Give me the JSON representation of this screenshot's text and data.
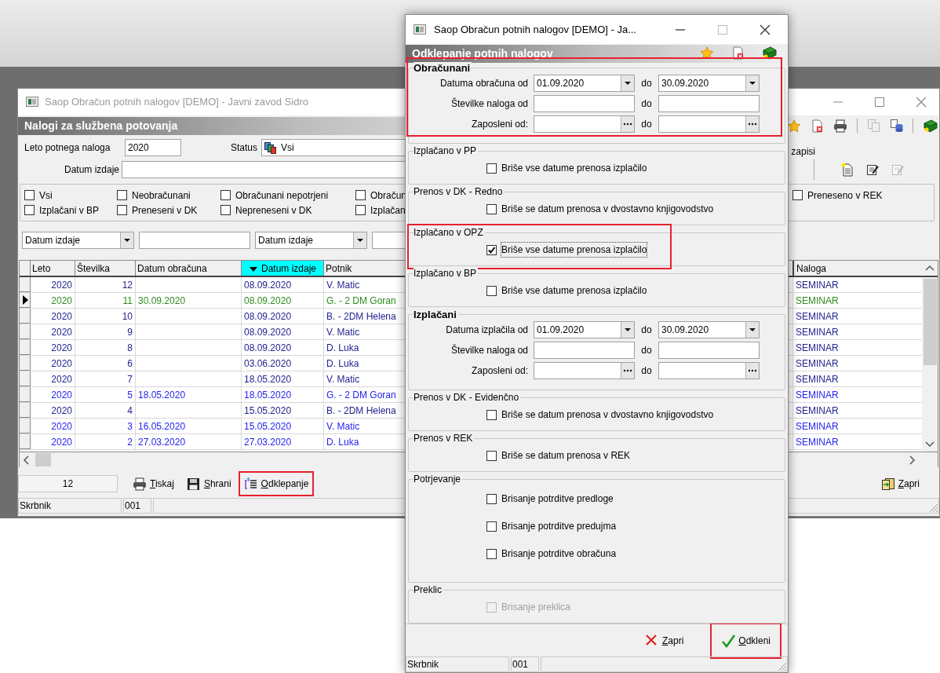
{
  "main_window": {
    "title": "Saop Obračun potnih nalogov [DEMO] - Javni zavod Sidro",
    "header": "Nalogi za službena potovanja",
    "year_label": "Leto potnega naloga",
    "year_value": "2020",
    "status_label": "Status",
    "status_value": "Vsi",
    "date_label": "Datum izdaje",
    "records_label": "zapisi",
    "filter_rows": [
      {
        "options": [
          {
            "label": "Vsi",
            "checked": false
          },
          {
            "label": "Neobračunani",
            "checked": false
          },
          {
            "label": "Obračunani nepotrjeni",
            "checked": false
          },
          {
            "label": "Obračun",
            "checked": false
          },
          {
            "label": "Preneseno v REK",
            "checked": false
          }
        ]
      },
      {
        "options": [
          {
            "label": "Izplačani v BP",
            "checked": false
          },
          {
            "label": "Preneseni v DK",
            "checked": false
          },
          {
            "label": "Nepreneseni v DK",
            "checked": false
          },
          {
            "label": "Izplačan",
            "checked": false
          }
        ]
      }
    ],
    "search": [
      {
        "kind": "select",
        "value": "Datum izdaje"
      },
      {
        "kind": "field"
      },
      {
        "kind": "select",
        "value": "Datum izdaje"
      },
      {
        "kind": "field"
      }
    ],
    "table": {
      "columns": [
        {
          "label": "Leto",
          "sorted": false
        },
        {
          "label": "Številka",
          "sorted": false
        },
        {
          "label": "Datum obračuna",
          "sorted": false
        },
        {
          "label": "Datum izdaje",
          "sorted": true
        },
        {
          "label": "Potnik",
          "sorted": false
        },
        {
          "label": "Naloga",
          "sorted": false
        }
      ],
      "rows": [
        {
          "leto": "2020",
          "stevilka": "12",
          "datum_izdaje": "08.09.2020",
          "potnik": "V. Matic",
          "naloga": "SEMINAR",
          "color": "#23238f",
          "current": false
        },
        {
          "leto": "2020",
          "stevilka": "11",
          "datum_obracuna": "30.09.2020",
          "datum_izdaje": "08.09.2020",
          "potnik": "G. - 2 DM Goran",
          "naloga": "SEMINAR",
          "color": "#2e8b1e",
          "current": true
        },
        {
          "leto": "2020",
          "stevilka": "10",
          "datum_izdaje": "08.09.2020",
          "potnik": "B. - 2DM Helena",
          "naloga": "SEMINAR",
          "color": "#23238f",
          "current": false
        },
        {
          "leto": "2020",
          "stevilka": "9",
          "datum_izdaje": "08.09.2020",
          "potnik": "V. Matic",
          "naloga": "SEMINAR",
          "color": "#23238f",
          "current": false
        },
        {
          "leto": "2020",
          "stevilka": "8",
          "datum_izdaje": "08.09.2020",
          "potnik": "D. Luka",
          "naloga": "SEMINAR",
          "color": "#23238f",
          "current": false
        },
        {
          "leto": "2020",
          "stevilka": "6",
          "datum_izdaje": "03.06.2020",
          "potnik": "D. Luka",
          "naloga": "SEMINAR",
          "color": "#23238f",
          "current": false
        },
        {
          "leto": "2020",
          "stevilka": "7",
          "datum_izdaje": "18.05.2020",
          "potnik": "V. Matic",
          "naloga": "SEMINAR",
          "color": "#23238f",
          "current": false
        },
        {
          "leto": "2020",
          "stevilka": "5",
          "datum_obracuna": "18.05.2020",
          "datum_izdaje": "18.05.2020",
          "potnik": "G. - 2 DM Goran",
          "naloga": "SEMINAR",
          "color": "#2424f0",
          "current": false
        },
        {
          "leto": "2020",
          "stevilka": "4",
          "datum_izdaje": "15.05.2020",
          "potnik": "B. - 2DM Helena",
          "naloga": "SEMINAR",
          "color": "#23238f",
          "current": false
        },
        {
          "leto": "2020",
          "stevilka": "3",
          "datum_obracuna": "16.05.2020",
          "datum_izdaje": "15.05.2020",
          "potnik": "V. Matic",
          "naloga": "SEMINAR",
          "color": "#2424f0",
          "current": false
        },
        {
          "leto": "2020",
          "stevilka": "2",
          "datum_obracuna": "27.03.2020",
          "datum_izdaje": "27.03.2020",
          "potnik": "D. Luka",
          "naloga": "SEMINAR",
          "color": "#2424f0",
          "current": false
        }
      ]
    },
    "count": "12",
    "buttons": [
      {
        "kind": "print",
        "label": "Tiskaj",
        "highlighted": false
      },
      {
        "kind": "save",
        "label": "Shrani",
        "highlighted": false
      },
      {
        "kind": "unlock",
        "label": "Odklepanje",
        "highlighted": true
      }
    ],
    "close_button": {
      "label": "Zapri"
    },
    "status_bar": [
      "Skrbnik",
      "001"
    ]
  },
  "dialog": {
    "title": "Saop Obračun potnih nalogov [DEMO] - Ja...",
    "header": "Odklepanje potnih nalogov",
    "groups": [
      {
        "kind": "range",
        "title": "Obračunani",
        "highlighted": true,
        "rows": [
          {
            "label": "Datuma obračuna od",
            "kind": "date",
            "from": "01.09.2020",
            "to_label": "do",
            "to": "30.09.2020"
          },
          {
            "label": "Številke naloga od",
            "kind": "text",
            "to_label": "do"
          },
          {
            "label": "Zaposleni od:",
            "kind": "lookup",
            "to_label": "do"
          }
        ]
      },
      {
        "kind": "checks",
        "title": "Izplačano v PP",
        "highlighted": false,
        "options": [
          {
            "label": "Briše vse datume prenosa izplačilo",
            "checked": false,
            "disabled": false,
            "focused": false
          }
        ]
      },
      {
        "kind": "checks",
        "title": "Prenos v DK - Redno",
        "highlighted": false,
        "options": [
          {
            "label": "Briše se datum prenosa v dvostavno knjigovodstvo",
            "checked": false,
            "disabled": false,
            "focused": false
          }
        ]
      },
      {
        "kind": "checks",
        "title": "Izplačano v OPZ",
        "highlighted": true,
        "options": [
          {
            "label": "Briše vse datume prenosa izplačilo",
            "checked": true,
            "disabled": false,
            "focused": true
          }
        ]
      },
      {
        "kind": "checks",
        "title": "Izplačano v BP",
        "highlighted": false,
        "options": [
          {
            "label": "Briše vse datume prenosa izplačilo",
            "checked": false,
            "disabled": false,
            "focused": false
          }
        ]
      },
      {
        "kind": "range",
        "title": "Izplačani",
        "highlighted": false,
        "rows": [
          {
            "label": "Datuma izplačila od",
            "kind": "date",
            "from": "01.09.2020",
            "to_label": "do",
            "to": "30.09.2020"
          },
          {
            "label": "Številke naloga od",
            "kind": "text",
            "to_label": "do"
          },
          {
            "label": "Zaposleni od:",
            "kind": "lookup",
            "to_label": "do"
          }
        ]
      },
      {
        "kind": "checks",
        "title": "Prenos v DK - Evidenčno",
        "highlighted": false,
        "options": [
          {
            "label": "Briše se datum prenosa v dvostavno knjigovodstvo",
            "checked": false,
            "disabled": false,
            "focused": false
          }
        ]
      },
      {
        "kind": "checks",
        "title": "Prenos v REK",
        "highlighted": false,
        "options": [
          {
            "label": "Briše se datum prenosa v REK",
            "checked": false,
            "disabled": false,
            "focused": false
          }
        ]
      },
      {
        "kind": "checks",
        "title": "Potrjevanje",
        "highlighted": false,
        "options": [
          {
            "label": "Brisanje potrditve predloge",
            "checked": false,
            "disabled": false,
            "focused": false
          },
          {
            "label": "Brisanje potrditve predujma",
            "checked": false,
            "disabled": false,
            "focused": false
          },
          {
            "label": "Brisanje potrditve obračuna",
            "checked": false,
            "disabled": false,
            "focused": false
          }
        ]
      },
      {
        "kind": "checks",
        "title": "Preklic",
        "highlighted": false,
        "options": [
          {
            "label": "Brisanje preklica",
            "checked": false,
            "disabled": true,
            "focused": false
          }
        ]
      }
    ],
    "buttons": [
      {
        "kind": "close",
        "label": "Zapri",
        "highlighted": false
      },
      {
        "kind": "confirm",
        "label": "Odkleni",
        "highlighted": true
      }
    ],
    "status_bar": [
      "Skrbnik",
      "001"
    ]
  }
}
